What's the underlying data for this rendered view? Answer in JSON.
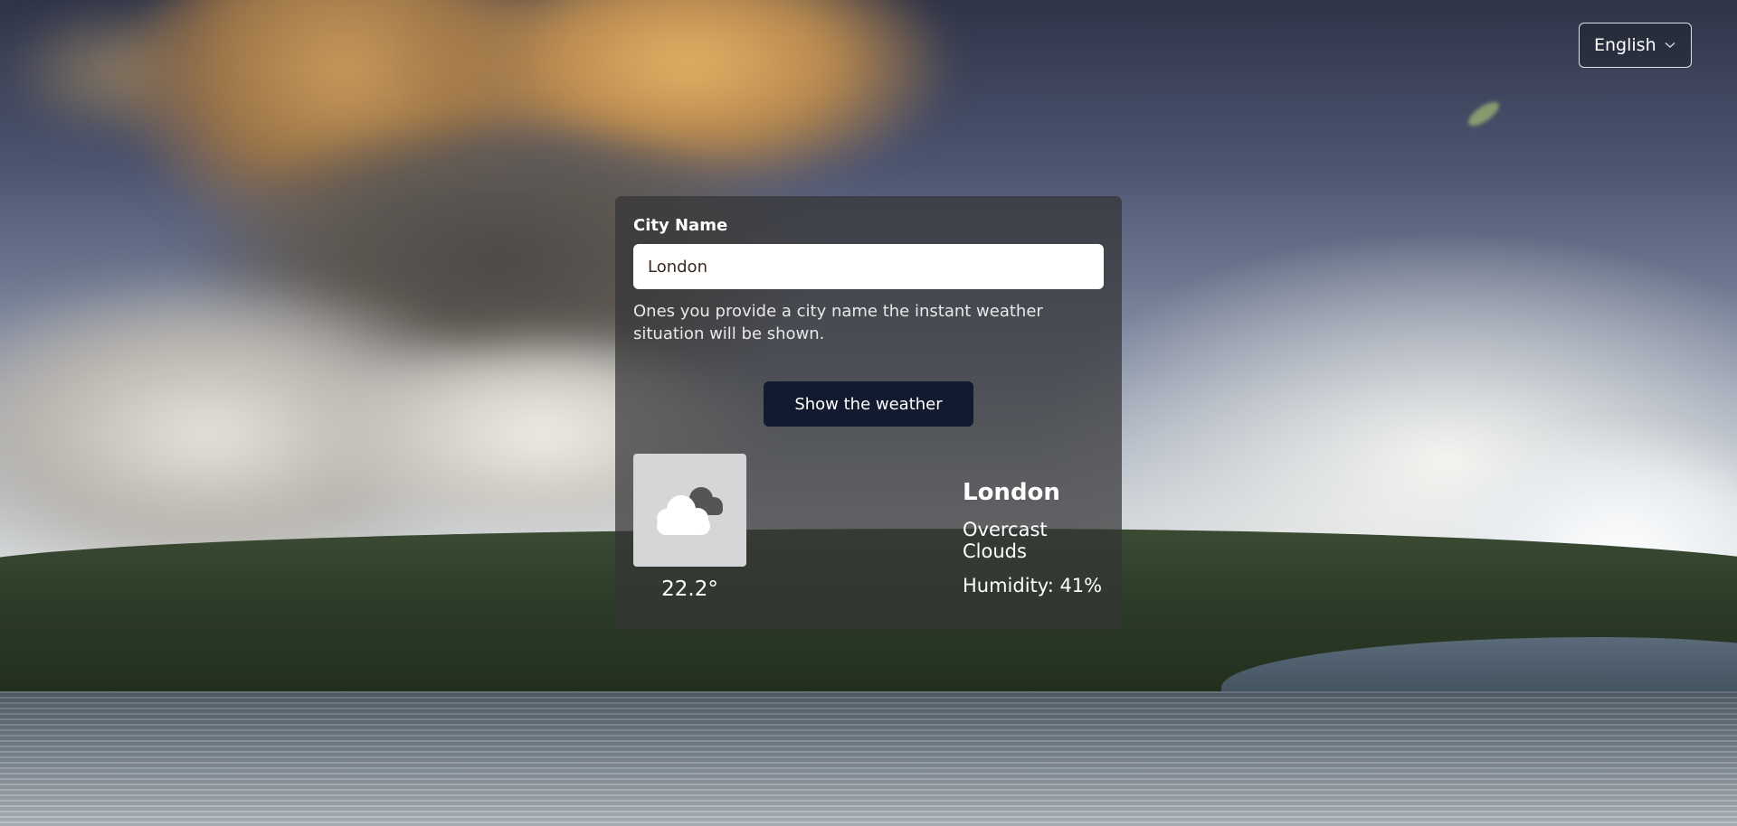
{
  "language_select": {
    "selected": "English"
  },
  "form": {
    "label": "City Name",
    "input_value": "London",
    "helper_text": "Ones you provide a city name the instant weather situation will be shown.",
    "button_label": "Show the weather"
  },
  "weather": {
    "icon": "overcast-clouds-icon",
    "temperature": "22.2°",
    "city": "London",
    "description": "Overcast Clouds",
    "humidity": "Humidity: 41%"
  },
  "colors": {
    "button_bg": "#111a2e",
    "card_bg": "rgba(52,52,54,0.72)",
    "icon_tile_bg": "#d6d6d8"
  }
}
